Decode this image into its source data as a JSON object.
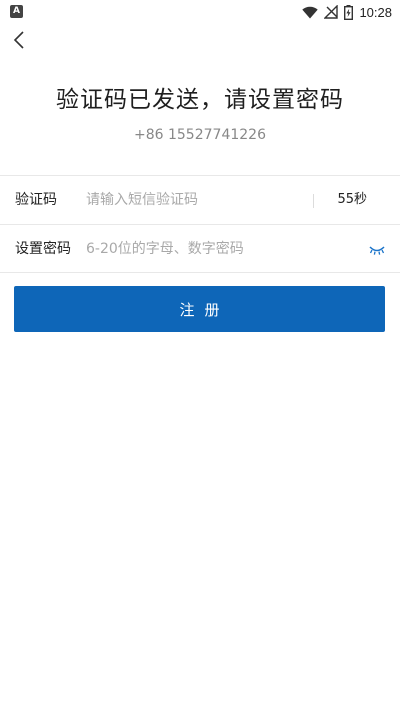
{
  "status_bar": {
    "left_icon_letter": "A",
    "time": "10:28",
    "icons": [
      "wifi-icon",
      "no-signal-icon",
      "battery-charging-icon"
    ]
  },
  "header": {
    "back_icon": "chevron-left-icon"
  },
  "headline": "验证码已发送，请设置密码",
  "phone_number": "+86 15527741226",
  "form": {
    "code_label": "验证码",
    "code_placeholder": "请输入短信验证码",
    "code_value": "",
    "countdown": "55秒",
    "password_label": "设置密码",
    "password_placeholder": "6-20位的字母、数字密码",
    "password_value": "",
    "eye_icon": "eye-closed-icon"
  },
  "register_button": "注册",
  "colors": {
    "accent": "#0e66b8",
    "eye_icon": "#1a73c9",
    "placeholder": "#a9a9a9",
    "divider": "#e8e8e8"
  }
}
